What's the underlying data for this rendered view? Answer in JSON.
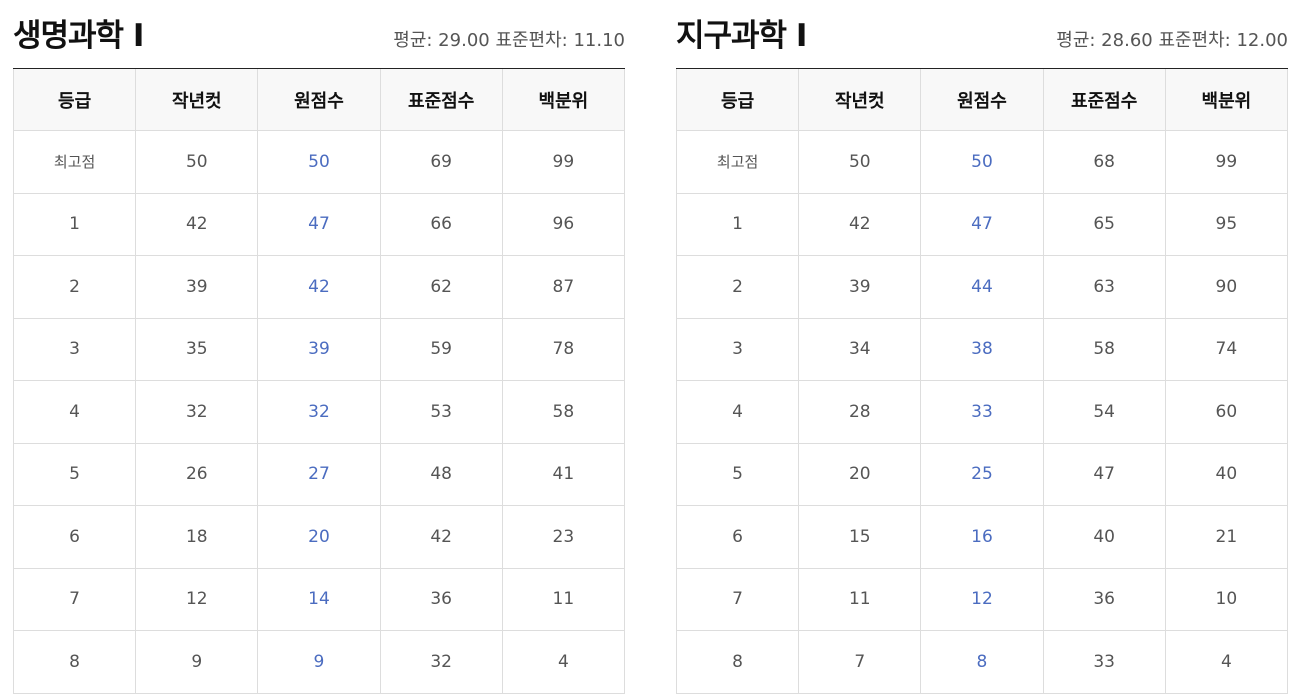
{
  "columns": [
    "등급",
    "작년컷",
    "원점수",
    "표준점수",
    "백분위"
  ],
  "colors": {
    "title": "#111111",
    "text": "#555555",
    "raw_score": "#4b6cc0",
    "header_bg": "#f8f8f8",
    "border": "#dddddd"
  },
  "panels": [
    {
      "title": "생명과학 Ⅰ",
      "stats": "평균: 29.00 표준편차: 11.10",
      "rows": [
        [
          "최고점",
          "50",
          "50",
          "69",
          "99"
        ],
        [
          "1",
          "42",
          "47",
          "66",
          "96"
        ],
        [
          "2",
          "39",
          "42",
          "62",
          "87"
        ],
        [
          "3",
          "35",
          "39",
          "59",
          "78"
        ],
        [
          "4",
          "32",
          "32",
          "53",
          "58"
        ],
        [
          "5",
          "26",
          "27",
          "48",
          "41"
        ],
        [
          "6",
          "18",
          "20",
          "42",
          "23"
        ],
        [
          "7",
          "12",
          "14",
          "36",
          "11"
        ],
        [
          "8",
          "9",
          "9",
          "32",
          "4"
        ]
      ]
    },
    {
      "title": "지구과학 Ⅰ",
      "stats": "평균: 28.60 표준편차: 12.00",
      "rows": [
        [
          "최고점",
          "50",
          "50",
          "68",
          "99"
        ],
        [
          "1",
          "42",
          "47",
          "65",
          "95"
        ],
        [
          "2",
          "39",
          "44",
          "63",
          "90"
        ],
        [
          "3",
          "34",
          "38",
          "58",
          "74"
        ],
        [
          "4",
          "28",
          "33",
          "54",
          "60"
        ],
        [
          "5",
          "20",
          "25",
          "47",
          "40"
        ],
        [
          "6",
          "15",
          "16",
          "40",
          "21"
        ],
        [
          "7",
          "11",
          "12",
          "36",
          "10"
        ],
        [
          "8",
          "7",
          "8",
          "33",
          "4"
        ]
      ]
    }
  ]
}
